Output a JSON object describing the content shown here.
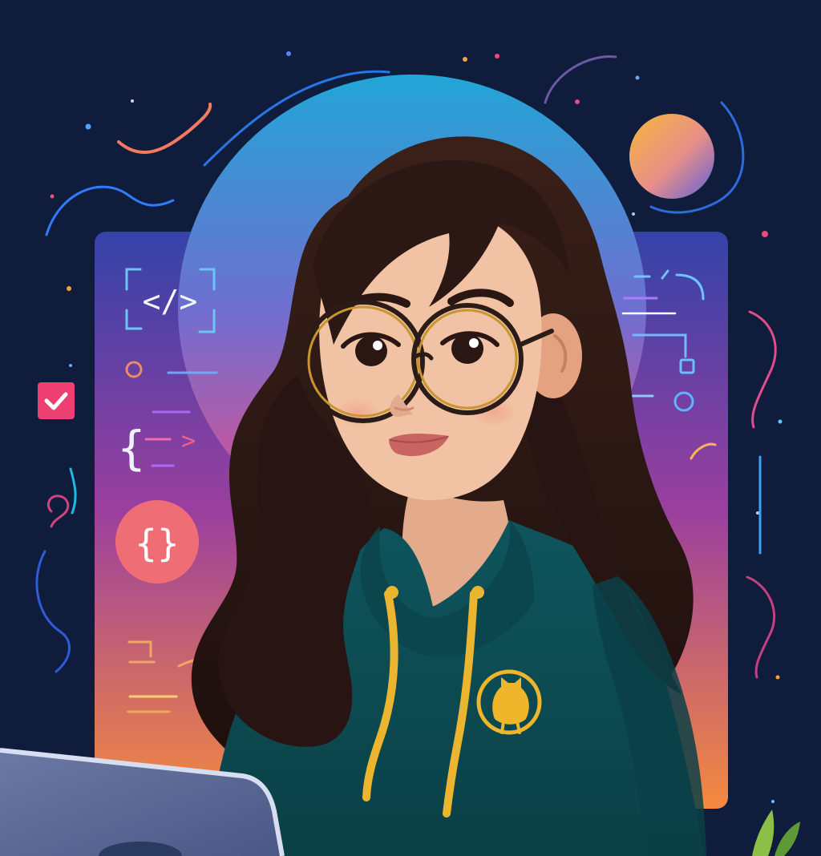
{
  "image": {
    "alt": "",
    "labels": {
      "close_tag": "</>",
      "braces": "{}",
      "open_brace": "{",
      "arrow": ">"
    },
    "colors": {
      "background": "#101c3b",
      "panel_top": "#3141a5",
      "panel_mid": "#9b3f9f",
      "panel_bottom": "#f48a3f",
      "halo_top": "#1fa9d3",
      "halo_bottom": "#e94a88",
      "hoodie": "#0d4b52",
      "hoodie_shadow": "#083a41",
      "hair": "#2b1714",
      "skin": "#f1c2a3",
      "lips": "#c86560",
      "glasses": "#2c1e1a",
      "glasses_rim": "#c9952f",
      "drawstring": "#e8b72e",
      "badge": "#f0b62b",
      "laptop": "#5f6d98",
      "accent_pink": "#ee3f73",
      "planet_top": "#f3aa3b",
      "planet_bottom": "#5b62d8"
    },
    "icons": [
      "code-tag-icon",
      "curly-braces-icon",
      "checkbox-icon",
      "octocat-badge-icon",
      "planet-icon",
      "laptop-icon",
      "plant-icon"
    ]
  }
}
